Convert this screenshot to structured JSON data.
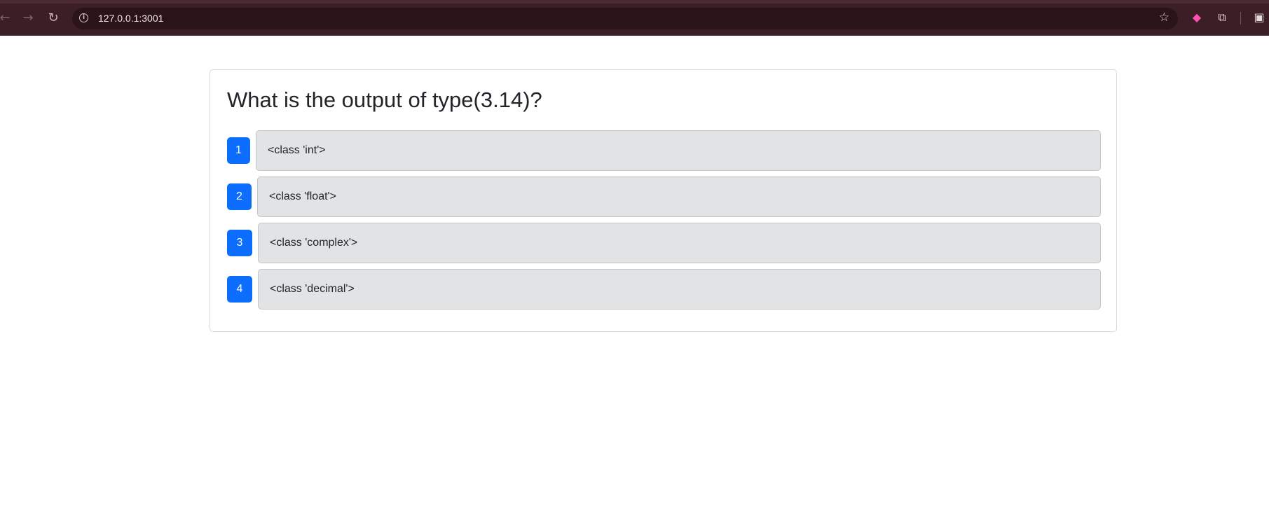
{
  "browser": {
    "url": "127.0.0.1:3001",
    "icons": {
      "back": "arrow-left-icon",
      "forward": "arrow-right-icon",
      "reload": "reload-icon",
      "site_info": "info-icon",
      "bookmark": "star-icon",
      "extension_pink": "extension-icon",
      "extensions": "puzzle-icon",
      "side_panel": "side-panel-icon"
    },
    "colors": {
      "toolbar": "#3b1f24",
      "omnibox": "#2a1418"
    }
  },
  "quiz": {
    "question": "What is the output of type(3.14)?",
    "options": [
      {
        "number": "1",
        "label": "<class 'int'>"
      },
      {
        "number": "2",
        "label": "<class 'float'>"
      },
      {
        "number": "3",
        "label": "<class 'complex'>"
      },
      {
        "number": "4",
        "label": "<class 'decimal'>"
      }
    ],
    "colors": {
      "badge": "#0d6efd",
      "option_bg": "#e2e3e5",
      "title": "#212529"
    }
  }
}
